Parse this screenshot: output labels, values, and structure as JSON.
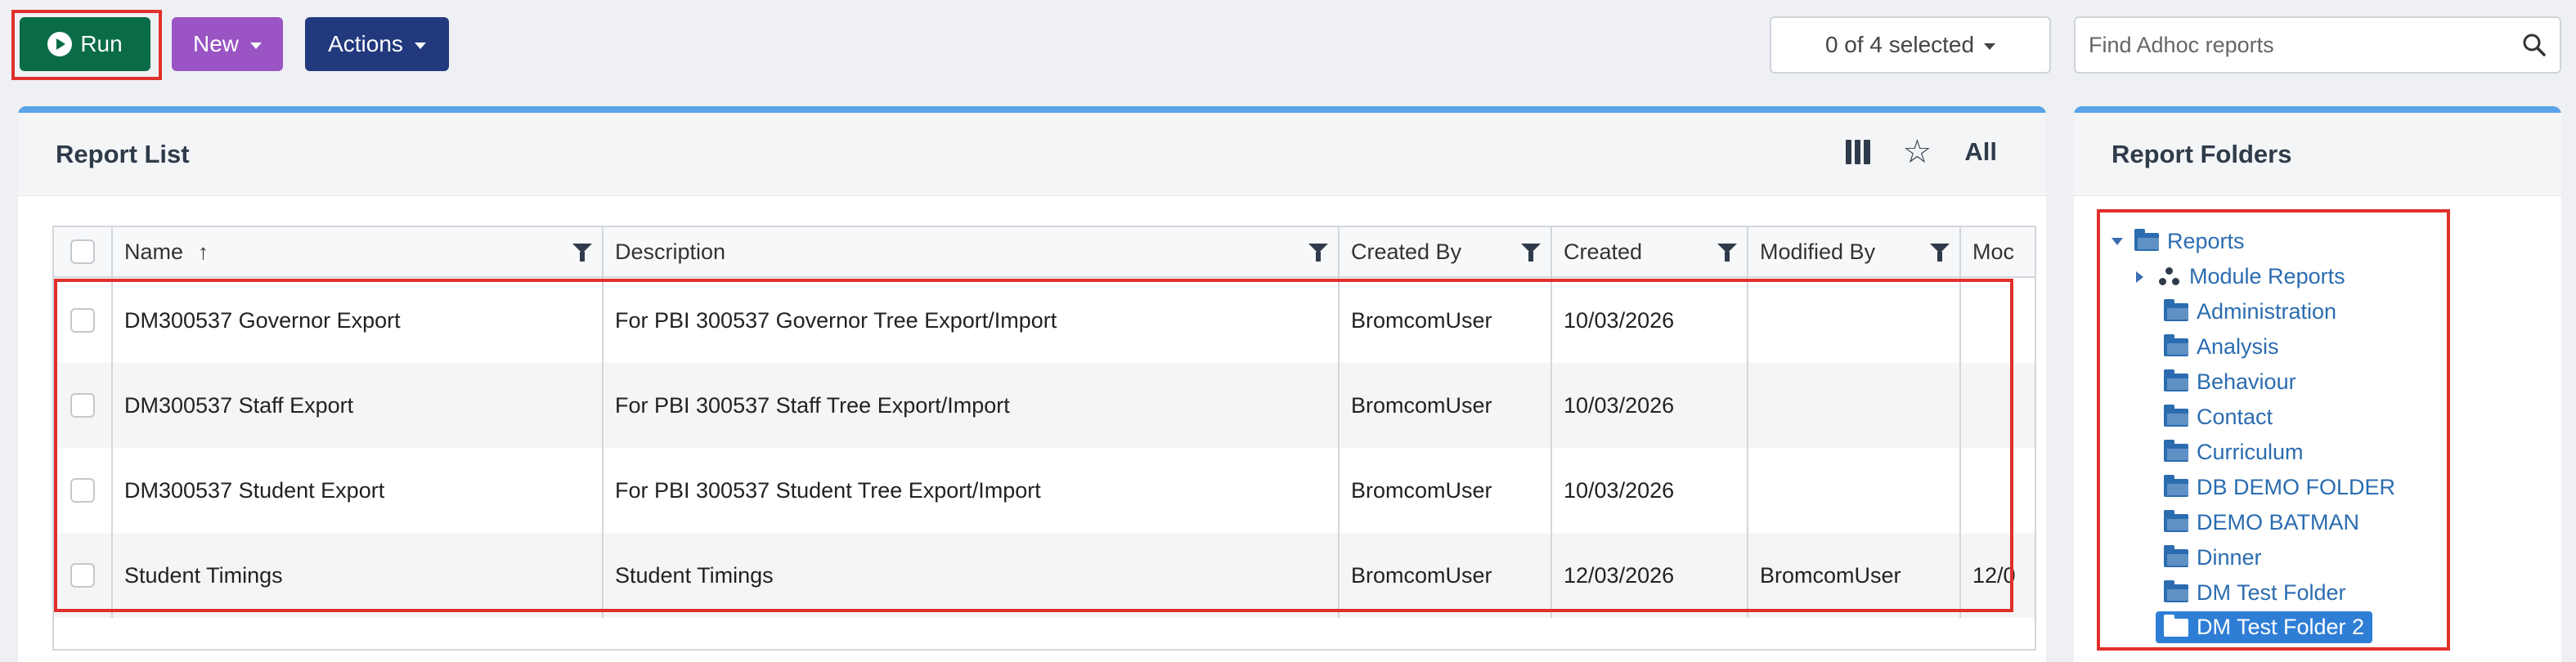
{
  "toolbar": {
    "run_label": "Run",
    "new_label": "New",
    "actions_label": "Actions",
    "selected_label": "0 of 4 selected",
    "search_placeholder": "Find Adhoc reports"
  },
  "report_list": {
    "title": "Report List",
    "all_label": "All",
    "columns": [
      "Name",
      "Description",
      "Created By",
      "Created",
      "Modified By",
      "Moc"
    ],
    "rows": [
      {
        "name": "DM300537 Governor Export",
        "description": "For PBI 300537 Governor Tree Export/Import",
        "created_by": "BromcomUser",
        "created": "10/03/2026",
        "modified_by": "",
        "modified": ""
      },
      {
        "name": "DM300537 Staff Export",
        "description": "For PBI 300537 Staff Tree Export/Import",
        "created_by": "BromcomUser",
        "created": "10/03/2026",
        "modified_by": "",
        "modified": ""
      },
      {
        "name": "DM300537 Student Export",
        "description": "For PBI 300537 Student Tree Export/Import",
        "created_by": "BromcomUser",
        "created": "10/03/2026",
        "modified_by": "",
        "modified": ""
      },
      {
        "name": "Student Timings",
        "description": "Student Timings",
        "created_by": "BromcomUser",
        "created": "12/03/2026",
        "modified_by": "BromcomUser",
        "modified": "12/0"
      }
    ]
  },
  "folders": {
    "title": "Report Folders",
    "root": "Reports",
    "items": [
      "Module Reports",
      "Administration",
      "Analysis",
      "Behaviour",
      "Contact",
      "Curriculum",
      "DB DEMO FOLDER",
      "DEMO BATMAN",
      "Dinner",
      "DM Test Folder",
      "DM Test Folder 2"
    ]
  }
}
